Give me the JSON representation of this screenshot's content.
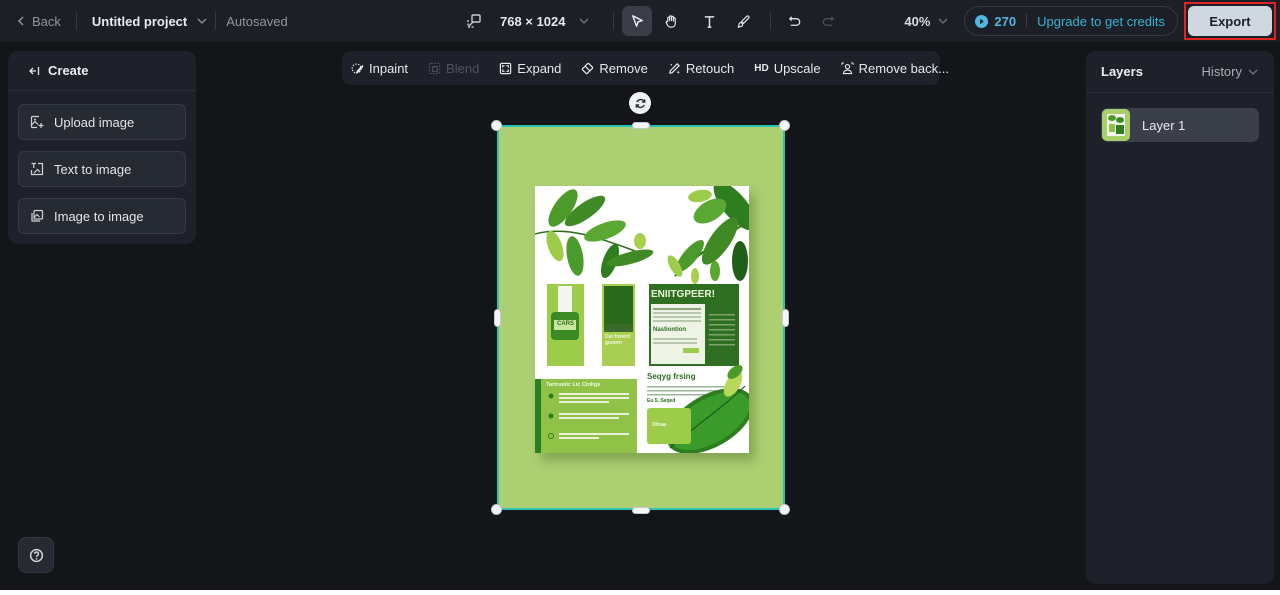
{
  "topbar": {
    "back_label": "Back",
    "project_name": "Untitled project",
    "save_status": "Autosaved",
    "canvas_size": "768 × 1024",
    "tools": [
      {
        "name": "select",
        "icon": "cursor-arrow-icon",
        "active": true
      },
      {
        "name": "hand",
        "icon": "hand-icon",
        "active": false
      },
      {
        "name": "text",
        "icon": "text-icon",
        "active": false
      },
      {
        "name": "brush",
        "icon": "brush-icon",
        "active": false
      }
    ],
    "undo_icon": "undo-icon",
    "redo_icon": "redo-icon",
    "zoom_level": "40%",
    "credits": "270",
    "upgrade_label": "Upgrade to get credits",
    "export_label": "Export",
    "accent_color": "#38b3d6",
    "highlight_color": "#e02424"
  },
  "left_panel": {
    "title": "Create",
    "buttons": [
      {
        "label": "Upload image",
        "icon": "upload-image-icon"
      },
      {
        "label": "Text to image",
        "icon": "text-to-image-icon"
      },
      {
        "label": "Image to image",
        "icon": "image-to-image-icon"
      }
    ],
    "help_icon": "help-icon"
  },
  "edit_toolbar": {
    "items": [
      {
        "label": "Inpaint",
        "icon": "inpaint-icon",
        "enabled": true
      },
      {
        "label": "Blend",
        "icon": "blend-icon",
        "enabled": false
      },
      {
        "label": "Expand",
        "icon": "expand-icon",
        "enabled": true
      },
      {
        "label": "Remove",
        "icon": "eraser-icon",
        "enabled": true
      },
      {
        "label": "Retouch",
        "icon": "retouch-icon",
        "enabled": true
      },
      {
        "label": "Upscale",
        "icon_text": "HD",
        "enabled": true
      },
      {
        "label": "Remove back...",
        "icon": "remove-background-icon",
        "enabled": true
      }
    ]
  },
  "canvas": {
    "background_color": "#acd071",
    "selection_color": "#2bc0b4",
    "poster": {
      "headline": "ENIITGPEER!",
      "subhead_left": "Nastiontion",
      "product_label": "CARS",
      "side_title": "Cer fonent geoorn",
      "section_title": "Tartrustic Lic Cinligs",
      "lower_title": "Seqyg frsing",
      "lower_sub": "Eu 5. Seqed",
      "leaf_card": "Oihaa"
    }
  },
  "right_panel": {
    "title": "Layers",
    "history_label": "History",
    "layers": [
      {
        "name": "Layer 1"
      }
    ]
  }
}
